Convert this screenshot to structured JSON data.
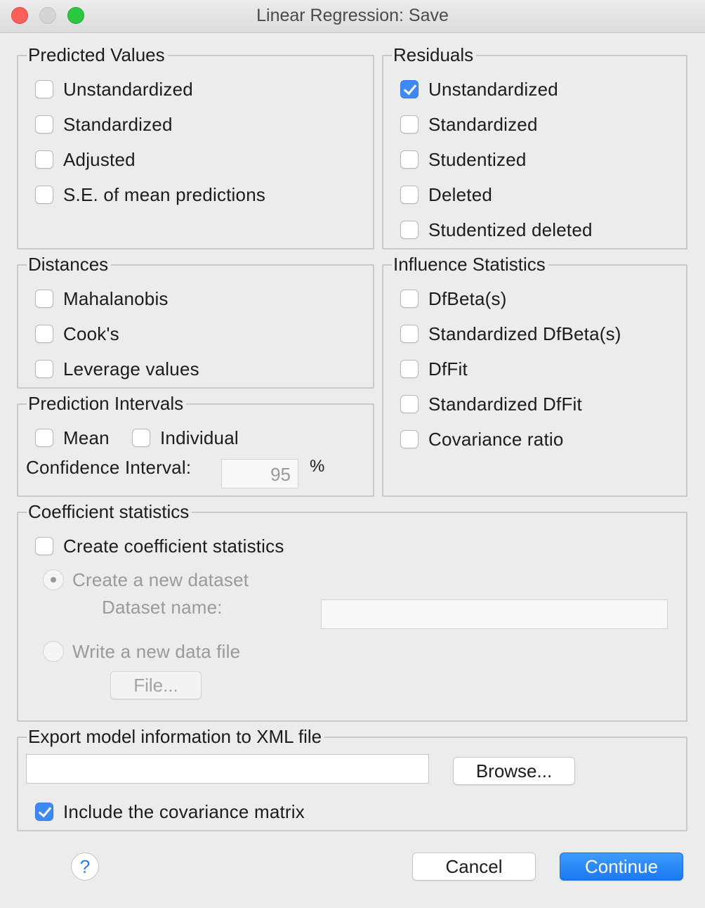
{
  "window": {
    "title": "Linear Regression: Save"
  },
  "predicted_values": {
    "legend": "Predicted Values",
    "items": [
      {
        "label": "Unstandardized",
        "checked": false
      },
      {
        "label": "Standardized",
        "checked": false
      },
      {
        "label": "Adjusted",
        "checked": false
      },
      {
        "label": "S.E. of mean predictions",
        "checked": false
      }
    ]
  },
  "residuals": {
    "legend": "Residuals",
    "items": [
      {
        "label": "Unstandardized",
        "checked": true
      },
      {
        "label": "Standardized",
        "checked": false
      },
      {
        "label": "Studentized",
        "checked": false
      },
      {
        "label": "Deleted",
        "checked": false
      },
      {
        "label": "Studentized deleted",
        "checked": false
      }
    ]
  },
  "distances": {
    "legend": "Distances",
    "items": [
      {
        "label": "Mahalanobis",
        "checked": false
      },
      {
        "label": "Cook's",
        "checked": false
      },
      {
        "label": "Leverage values",
        "checked": false
      }
    ]
  },
  "influence_statistics": {
    "legend": "Influence Statistics",
    "items": [
      {
        "label": "DfBeta(s)",
        "checked": false
      },
      {
        "label": "Standardized DfBeta(s)",
        "checked": false
      },
      {
        "label": "DfFit",
        "checked": false
      },
      {
        "label": "Standardized DfFit",
        "checked": false
      },
      {
        "label": "Covariance ratio",
        "checked": false
      }
    ]
  },
  "prediction_intervals": {
    "legend": "Prediction Intervals",
    "mean_label": "Mean",
    "individual_label": "Individual",
    "confidence_label": "Confidence Interval:",
    "confidence_value": "95",
    "percent_sign": "%"
  },
  "coefficient_statistics": {
    "legend": "Coefficient statistics",
    "create_label": "Create coefficient statistics",
    "new_dataset_label": "Create a new dataset",
    "dataset_name_label": "Dataset name:",
    "dataset_name_value": "",
    "write_file_label": "Write a new data file",
    "file_button": "File..."
  },
  "export_xml": {
    "legend": "Export model information to XML file",
    "path_value": "",
    "browse_button": "Browse...",
    "include_covariance_label": "Include the covariance matrix",
    "include_covariance_checked": true
  },
  "footer": {
    "help_glyph": "?",
    "cancel_button": "Cancel",
    "continue_button": "Continue"
  },
  "colors": {
    "accent": "#1a79f0",
    "close": "#fc5f57",
    "maximize": "#2bc840"
  }
}
